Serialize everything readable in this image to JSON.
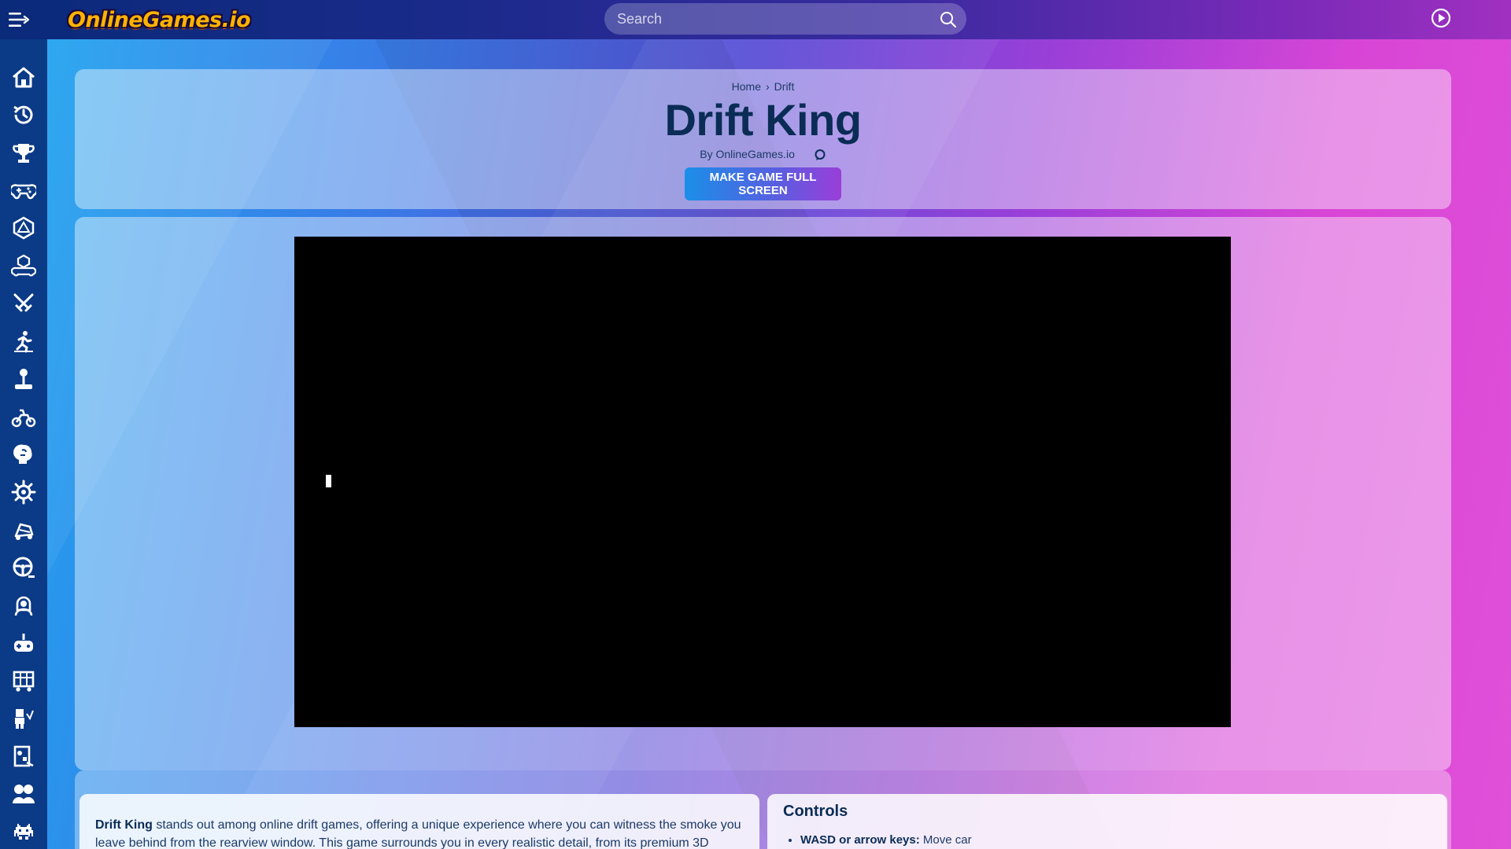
{
  "topbar": {
    "logo_text": "OnlineGames.io",
    "search_placeholder": "Search"
  },
  "sidebar": {
    "items": [
      {
        "name": "home",
        "icon": "home-icon"
      },
      {
        "name": "recent",
        "icon": "history-icon"
      },
      {
        "name": "trophy",
        "icon": "trophy-icon"
      },
      {
        "name": "controller",
        "icon": "gamepad-icon"
      },
      {
        "name": "io-games",
        "icon": "d20-icon"
      },
      {
        "name": "3d-games",
        "icon": "cube-gamepad-icon"
      },
      {
        "name": "fighting",
        "icon": "crossed-swords-icon"
      },
      {
        "name": "sports",
        "icon": "runner-icon"
      },
      {
        "name": "arcade",
        "icon": "joystick-icon"
      },
      {
        "name": "racing",
        "icon": "motorbike-icon"
      },
      {
        "name": "puzzle",
        "icon": "brain-icon"
      },
      {
        "name": "skill",
        "icon": "gear-icon"
      },
      {
        "name": "drift",
        "icon": "drift-car-icon"
      },
      {
        "name": "driving",
        "icon": "steering-wheel-icon"
      },
      {
        "name": "girls",
        "icon": "girl-icon"
      },
      {
        "name": "multiplayer",
        "icon": "controller-plus-icon"
      },
      {
        "name": "strategy",
        "icon": "truck-icon"
      },
      {
        "name": "minecraft",
        "icon": "blocky-character-icon"
      },
      {
        "name": "board",
        "icon": "board-game-icon"
      },
      {
        "name": "2-player",
        "icon": "two-players-icon"
      },
      {
        "name": "retro",
        "icon": "space-invader-icon"
      }
    ]
  },
  "header": {
    "breadcrumb": {
      "home": "Home",
      "sep": "›",
      "current": "Drift"
    },
    "title": "Drift King",
    "byline": "By OnlineGames.io",
    "fullscreen_button": "MAKE GAME FULL SCREEN"
  },
  "description": {
    "game_name": "Drift King",
    "text": " stands out among online drift games, offering a unique experience where you can witness the smoke you leave behind from the rearview window. This game surrounds you in every realistic detail, from its premium 3D"
  },
  "controls": {
    "title": "Controls",
    "items": [
      {
        "key": "WASD or arrow keys:",
        "action": " Move car"
      }
    ]
  },
  "colors": {
    "sidebar": "#0b3a86",
    "title": "#0a2c55",
    "button_start": "#1a8fe8",
    "button_end": "#9a3ed8",
    "game_bg": "#000000"
  }
}
